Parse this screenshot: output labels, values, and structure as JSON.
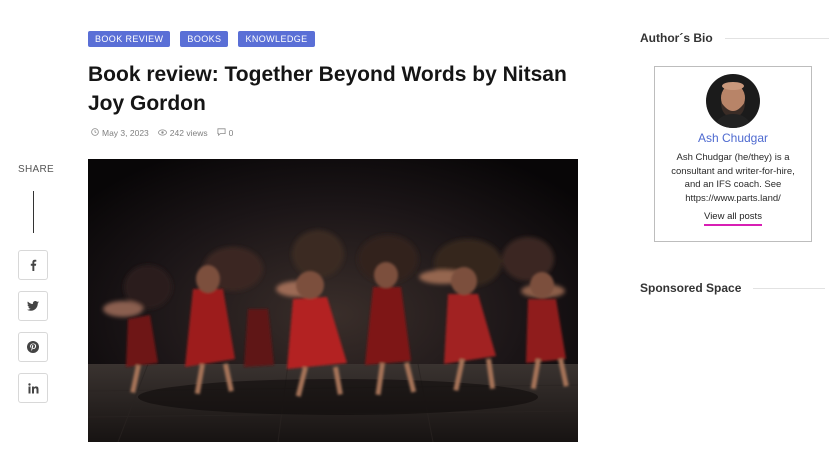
{
  "tags": [
    "BOOK REVIEW",
    "BOOKS",
    "KNOWLEDGE"
  ],
  "post": {
    "title": "Book review: Together Beyond Words by Nitsan Joy Gordon",
    "date": "May 3, 2023",
    "views": "242 views",
    "comments": "0",
    "image_alt": "Dancers in red dresses moving in motion blur on a dark stage"
  },
  "share": {
    "label": "SHARE",
    "buttons": [
      "facebook-icon",
      "twitter-icon",
      "pinterest-icon",
      "linkedin-icon"
    ]
  },
  "sidebar": {
    "bio_heading": "Author´s Bio",
    "author_name": "Ash Chudgar",
    "author_bio": "Ash Chudgar (he/they) is a consultant and writer-for-hire, and an IFS coach. See https://www.parts.land/",
    "view_all_label": "View all posts",
    "sponsored_heading": "Sponsored Space"
  },
  "colors": {
    "tag_bg": "#5a6fd6",
    "author_name": "#4e6ad0",
    "link_underline": "#d81fb4"
  }
}
